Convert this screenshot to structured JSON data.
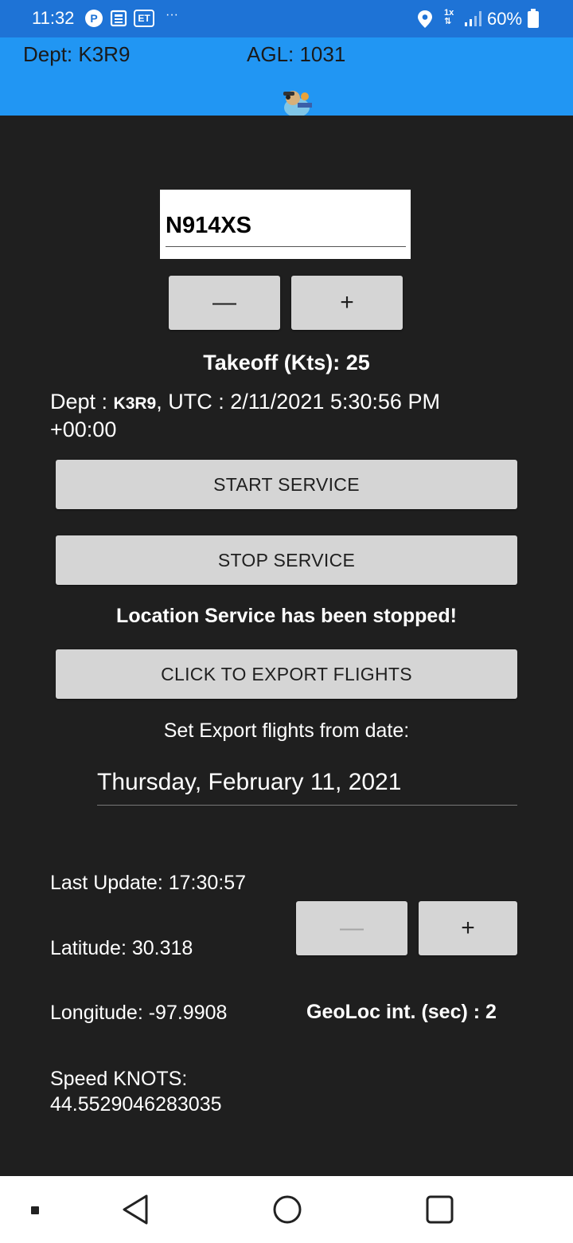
{
  "status_bar": {
    "time": "11:32",
    "notif_p": "P",
    "notif_et": "ET",
    "overflow": "···",
    "data_speed": "1x",
    "battery_pct": "60%",
    "colors": {
      "background": "#1e73d6"
    }
  },
  "header": {
    "dept": "Dept: K3R9",
    "agl": "AGL: 1031",
    "logo_icon": "pilot-avatar-icon",
    "colors": {
      "background": "#2196f3"
    }
  },
  "tail_entry": {
    "value": "N914XS"
  },
  "takeoff_stepper": {
    "minus": "—",
    "plus": "+"
  },
  "takeoff_label": "Takeoff (Kts): 25",
  "dept_line": {
    "prefix": "Dept : ",
    "code": "K3R9",
    "utc": ", UTC : 2/11/2021 5:30:56 PM",
    "offset": "+00:00"
  },
  "buttons": {
    "start": "START SERVICE",
    "stop": "STOP SERVICE",
    "export": "CLICK TO EXPORT FLIGHTS"
  },
  "service_status": "Location Service has been stopped!",
  "export": {
    "label": "Set Export flights from date:",
    "date": "Thursday, February 11, 2021"
  },
  "telemetry": {
    "last_update": "Last Update: 17:30:57",
    "latitude": "Latitude: 30.318",
    "longitude": "Longitude: -97.9908",
    "speed_label": "Speed KNOTS:",
    "speed_value": "44.5529046283035"
  },
  "geoloc_stepper": {
    "minus": "—",
    "plus": "+"
  },
  "geoloc_label": "GeoLoc int. (sec) : 2",
  "nav": {
    "recent": "recents-icon",
    "back": "back-icon",
    "home": "home-icon",
    "overview": "overview-icon"
  }
}
